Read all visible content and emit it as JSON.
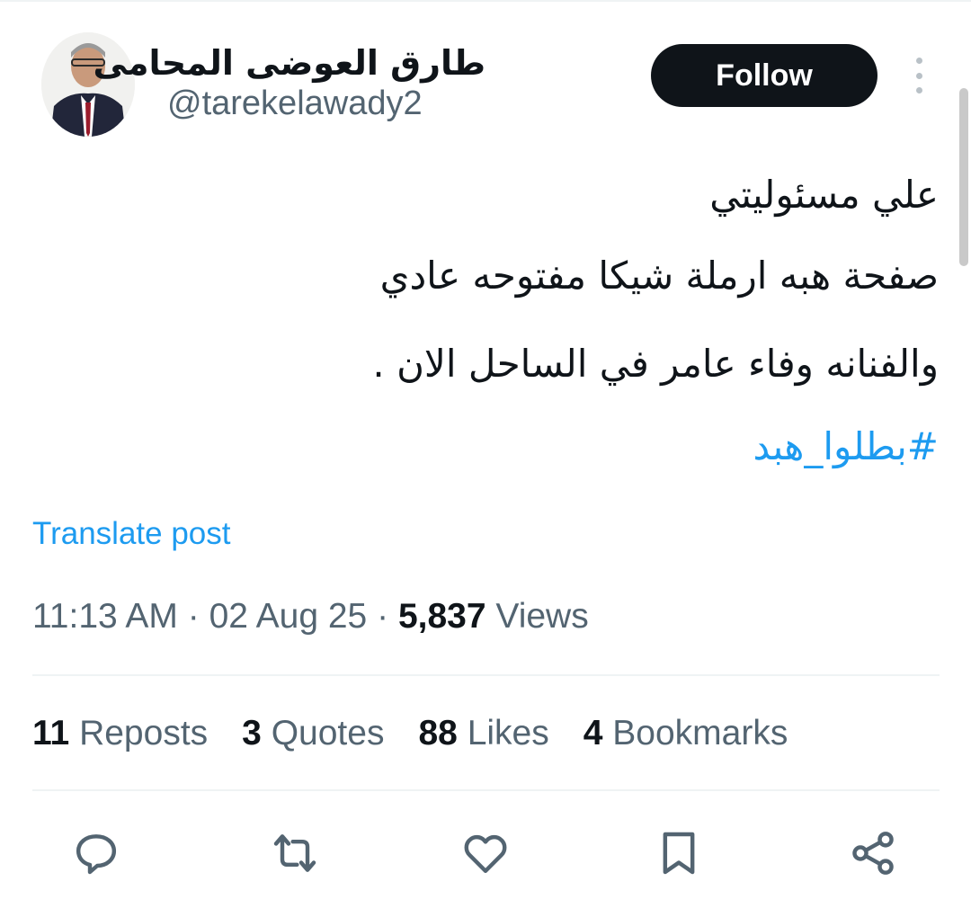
{
  "author": {
    "display_name": "طارق العوضى المحامى",
    "handle": "@tarekelawady2"
  },
  "follow_label": "Follow",
  "tweet": {
    "lines": [
      "علي مسئوليتي",
      "صفحة هبه ارملة شيكا مفتوحه عادي",
      "والفنانه وفاء عامر في الساحل الان ."
    ],
    "hashtag": "#بطلوا_هبد"
  },
  "translate_label": "Translate post",
  "meta": {
    "time": "11:13 AM",
    "separator": "·",
    "date": "02 Aug 25",
    "views_count": "5,837",
    "views_label": "Views"
  },
  "stats": {
    "reposts_count": "11",
    "reposts_label": "Reposts",
    "quotes_count": "3",
    "quotes_label": "Quotes",
    "likes_count": "88",
    "likes_label": "Likes",
    "bookmarks_count": "4",
    "bookmarks_label": "Bookmarks"
  },
  "icons": {
    "reply": "reply-icon",
    "repost": "repost-icon",
    "like": "heart-icon",
    "bookmark": "bookmark-icon",
    "share": "share-icon",
    "more": "more-vertical-icon"
  },
  "colors": {
    "text": "#0f1419",
    "secondary": "#536471",
    "link": "#1d9bf0",
    "button_bg": "#0f1419",
    "divider": "#eff3f4"
  }
}
